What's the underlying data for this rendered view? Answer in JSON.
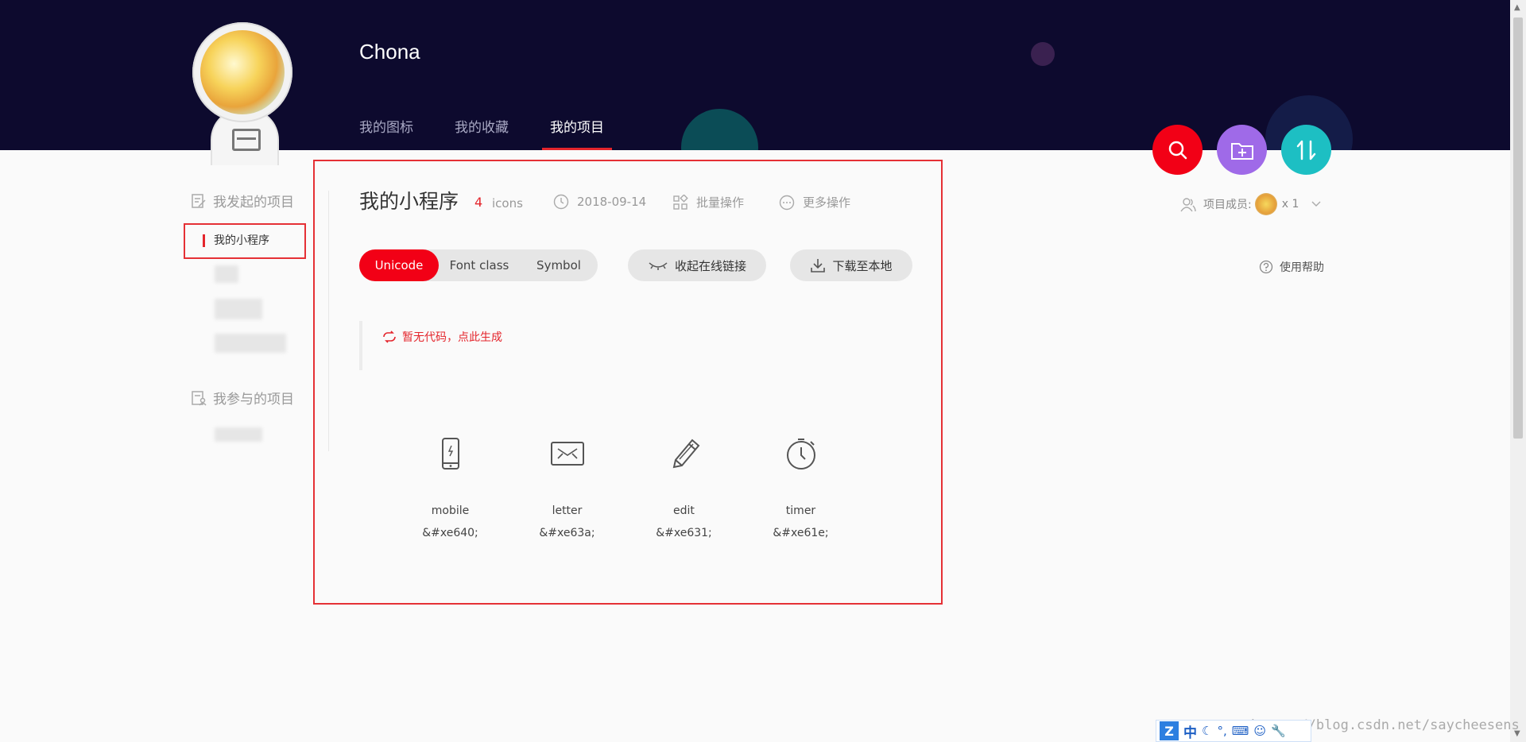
{
  "header": {
    "username": "Chona",
    "nav": [
      "我的图标",
      "我的收藏",
      "我的项目"
    ],
    "active_nav": "我的项目"
  },
  "sidebar": {
    "group_started": "我发起的项目",
    "active_item": "我的小程序",
    "group_joined": "我参与的项目"
  },
  "project": {
    "title": "我的小程序",
    "count": "4",
    "count_unit": "icons",
    "date": "2018-09-14",
    "batch_label": "批量操作",
    "more_label": "更多操作",
    "members_label": "项目成员:",
    "members_count": "x 1",
    "help_label": "使用帮助"
  },
  "tabs": {
    "options": [
      "Unicode",
      "Font class",
      "Symbol"
    ],
    "active": "Unicode"
  },
  "actions": {
    "collapse_link": "收起在线链接",
    "download": "下载至本地"
  },
  "code": {
    "message": "暂无代码，点此生成"
  },
  "icons": [
    {
      "name": "mobile",
      "code": "&#xe640;",
      "icon": "mobile-icon"
    },
    {
      "name": "letter",
      "code": "&#xe63a;",
      "icon": "letter-icon"
    },
    {
      "name": "edit",
      "code": "&#xe631;",
      "icon": "edit-icon"
    },
    {
      "name": "timer",
      "code": "&#xe61e;",
      "icon": "timer-icon"
    }
  ],
  "footer": {
    "ime_lang": "中",
    "watermark": "https://blog.csdn.net/saycheesens"
  },
  "colors": {
    "header_bg": "#0d0a2e",
    "accent_red": "#f20016",
    "fab_purple": "#9f6ae8",
    "fab_teal": "#1dbfc3"
  }
}
